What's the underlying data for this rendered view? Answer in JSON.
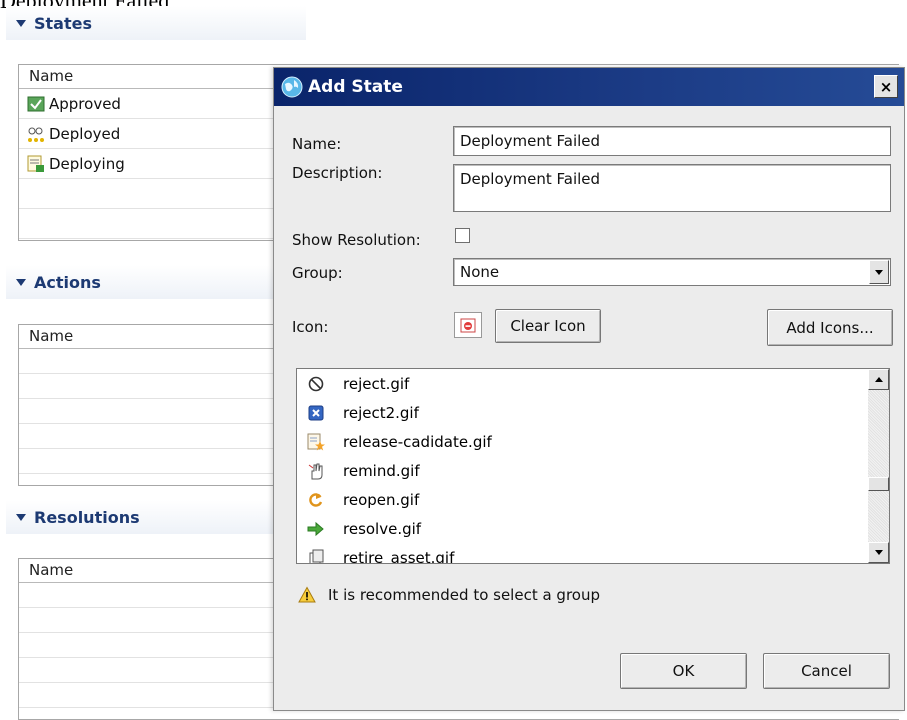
{
  "background": {
    "clipped_text": "Deployment Failed",
    "states": {
      "header": "States",
      "column": "Name",
      "rows": [
        {
          "label": "Approved",
          "icon": "approved-icon"
        },
        {
          "label": "Deployed",
          "icon": "deployed-icon"
        },
        {
          "label": "Deploying",
          "icon": "deploying-icon"
        }
      ]
    },
    "actions": {
      "header": "Actions",
      "column": "Name"
    },
    "resolutions": {
      "header": "Resolutions",
      "column": "Name"
    }
  },
  "dialog": {
    "title": "Add State",
    "close_label": "×",
    "name_label": "Name:",
    "name_value": "Deployment Failed",
    "description_label": "Description:",
    "description_value": "Deployment Failed",
    "show_resolution_label": "Show Resolution:",
    "show_resolution_checked": false,
    "group_label": "Group:",
    "group_value": "None",
    "icon_label": "Icon:",
    "clear_icon_label": "Clear Icon",
    "add_icons_label": "Add Icons...",
    "icon_list": [
      {
        "name": "reject.gif",
        "icon": "no-entry-icon"
      },
      {
        "name": "reject2.gif",
        "icon": "blue-x-icon"
      },
      {
        "name": "release-cadidate.gif",
        "icon": "release-star-icon"
      },
      {
        "name": "remind.gif",
        "icon": "remind-hand-icon"
      },
      {
        "name": "reopen.gif",
        "icon": "reopen-arrow-icon"
      },
      {
        "name": "resolve.gif",
        "icon": "green-arrow-icon"
      },
      {
        "name": "retire_asset.gif",
        "icon": "retire-asset-icon"
      }
    ],
    "warning_text": "It is recommended to select a group",
    "ok_label": "OK",
    "cancel_label": "Cancel"
  },
  "colors": {
    "titlebar": "#0a246a",
    "section_header_text": "#1d3a73",
    "dialog_bg": "#ececec"
  }
}
